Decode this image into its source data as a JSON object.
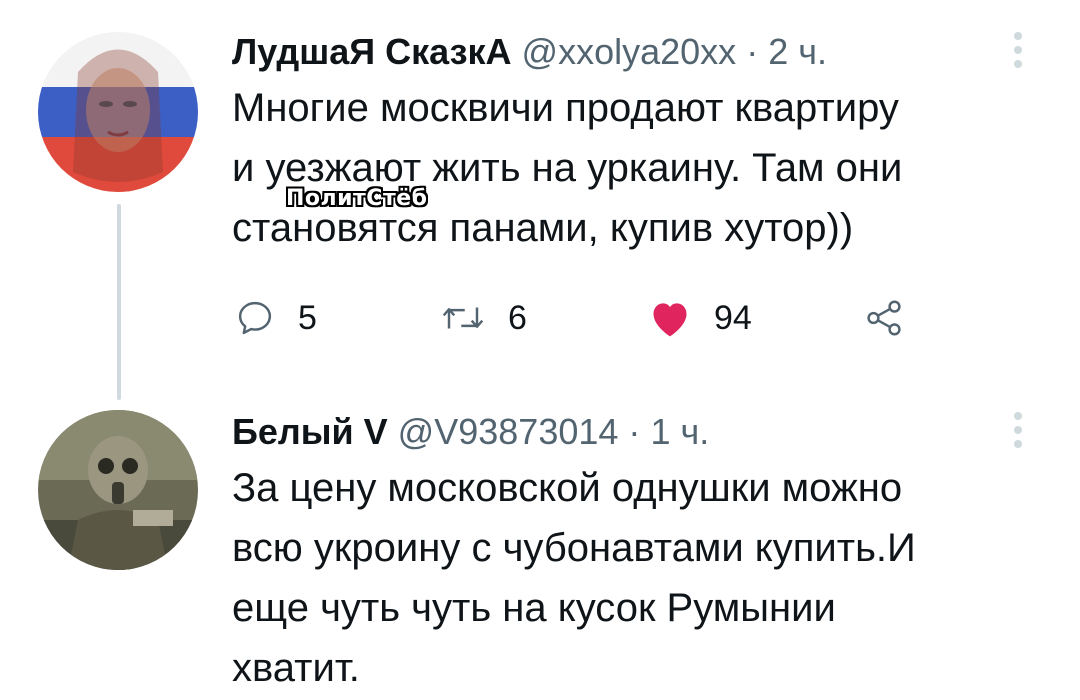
{
  "tweets": [
    {
      "author_name": "ЛудшаЯ СказкА",
      "handle": "@xxolya20xx",
      "separator": "·",
      "time": "2 ч.",
      "text_lines": [
        "Многие москвичи  продают квартиру",
        "и уезжают жить на уркаину. Там они",
        "становятся панами, купив хутор))"
      ],
      "watermark": "ПолитСтёб",
      "actions": {
        "reply_count": "5",
        "retweet_count": "6",
        "like_count": "94"
      },
      "icons": {
        "reply": "reply-icon",
        "retweet": "retweet-icon",
        "like": "heart-icon",
        "share": "share-icon",
        "more": "more-vertical-icon"
      }
    },
    {
      "author_name": "Белый V",
      "handle": "@V93873014",
      "separator": "·",
      "time": "1 ч.",
      "text_lines": [
        "За цену московской однушки можно",
        "всю укроину с чубонавтами купить.И",
        "еще чуть чуть на кусок Румынии",
        "хватит."
      ],
      "icons": {
        "more": "more-vertical-icon"
      }
    }
  ],
  "colors": {
    "like_active": "#e0245e",
    "icon_gray": "#536471",
    "thread_line": "#cfd9de",
    "text": "#0f1419"
  }
}
